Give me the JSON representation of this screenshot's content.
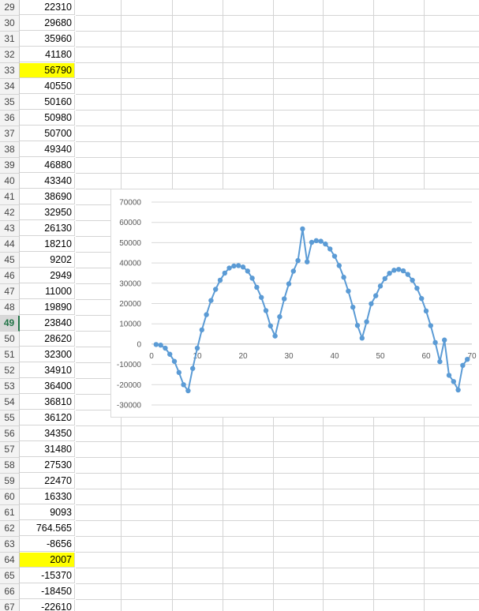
{
  "sheet": {
    "selected_row": 49,
    "rows": [
      {
        "num": "29",
        "value": "22310"
      },
      {
        "num": "30",
        "value": "29680"
      },
      {
        "num": "31",
        "value": "35960"
      },
      {
        "num": "32",
        "value": "41180"
      },
      {
        "num": "33",
        "value": "56790",
        "highlight": true
      },
      {
        "num": "34",
        "value": "40550"
      },
      {
        "num": "35",
        "value": "50160"
      },
      {
        "num": "36",
        "value": "50980"
      },
      {
        "num": "37",
        "value": "50700"
      },
      {
        "num": "38",
        "value": "49340"
      },
      {
        "num": "39",
        "value": "46880"
      },
      {
        "num": "40",
        "value": "43340"
      },
      {
        "num": "41",
        "value": "38690"
      },
      {
        "num": "42",
        "value": "32950"
      },
      {
        "num": "43",
        "value": "26130"
      },
      {
        "num": "44",
        "value": "18210"
      },
      {
        "num": "45",
        "value": "9202"
      },
      {
        "num": "46",
        "value": "2949"
      },
      {
        "num": "47",
        "value": "11000"
      },
      {
        "num": "48",
        "value": "19890"
      },
      {
        "num": "49",
        "value": "23840"
      },
      {
        "num": "50",
        "value": "28620"
      },
      {
        "num": "51",
        "value": "32300"
      },
      {
        "num": "52",
        "value": "34910"
      },
      {
        "num": "53",
        "value": "36400"
      },
      {
        "num": "54",
        "value": "36810"
      },
      {
        "num": "55",
        "value": "36120"
      },
      {
        "num": "56",
        "value": "34350"
      },
      {
        "num": "57",
        "value": "31480"
      },
      {
        "num": "58",
        "value": "27530"
      },
      {
        "num": "59",
        "value": "22470"
      },
      {
        "num": "60",
        "value": "16330"
      },
      {
        "num": "61",
        "value": "9093"
      },
      {
        "num": "62",
        "value": "764.565"
      },
      {
        "num": "63",
        "value": "-8656"
      },
      {
        "num": "64",
        "value": "2007",
        "highlight": true
      },
      {
        "num": "65",
        "value": "-15370"
      },
      {
        "num": "66",
        "value": "-18450"
      },
      {
        "num": "67",
        "value": "-22610"
      }
    ]
  },
  "chart_data": {
    "type": "scatter",
    "xlim": [
      0,
      70
    ],
    "ylim": [
      -30000,
      70000
    ],
    "x_ticks": [
      0,
      10,
      20,
      30,
      40,
      50,
      60,
      70
    ],
    "y_ticks": [
      70000,
      60000,
      50000,
      40000,
      30000,
      20000,
      10000,
      0,
      -10000,
      -20000,
      -30000
    ],
    "grid": "horizontal",
    "marker_color": "#5b9bd5",
    "line_color": "#5b9bd5",
    "series": [
      {
        "x": [
          1,
          2,
          3,
          4,
          5,
          6,
          7,
          8,
          9,
          10,
          11,
          12,
          13,
          14,
          15,
          16,
          17,
          18,
          19,
          20,
          21,
          22,
          23,
          24,
          25,
          26,
          27,
          28,
          29,
          30,
          31,
          32,
          33,
          34,
          35,
          36,
          37,
          38,
          39,
          40,
          41,
          42,
          43,
          44,
          45,
          46,
          47,
          48,
          49,
          50,
          51,
          52,
          53,
          54,
          55,
          56,
          57,
          58,
          59,
          60,
          61,
          62,
          63,
          64,
          65,
          66,
          67,
          68,
          69
        ],
        "y": [
          -200,
          -500,
          -2000,
          -5000,
          -8500,
          -14000,
          -20000,
          -23000,
          -12000,
          -2000,
          7000,
          14500,
          21500,
          27000,
          31500,
          35000,
          37500,
          38500,
          38700,
          38000,
          36000,
          32500,
          28000,
          23000,
          16500,
          9000,
          4000,
          13500,
          22310,
          29680,
          35960,
          41180,
          56790,
          40550,
          50160,
          50980,
          50700,
          49340,
          46880,
          43340,
          38690,
          32950,
          26130,
          18210,
          9202,
          2949,
          11000,
          19890,
          23840,
          28620,
          32300,
          34910,
          36400,
          36810,
          36120,
          34350,
          31480,
          27530,
          22470,
          16330,
          9093,
          764.565,
          -8656,
          2007,
          -15370,
          -18450,
          -22610,
          -10500,
          -7500
        ]
      }
    ]
  }
}
